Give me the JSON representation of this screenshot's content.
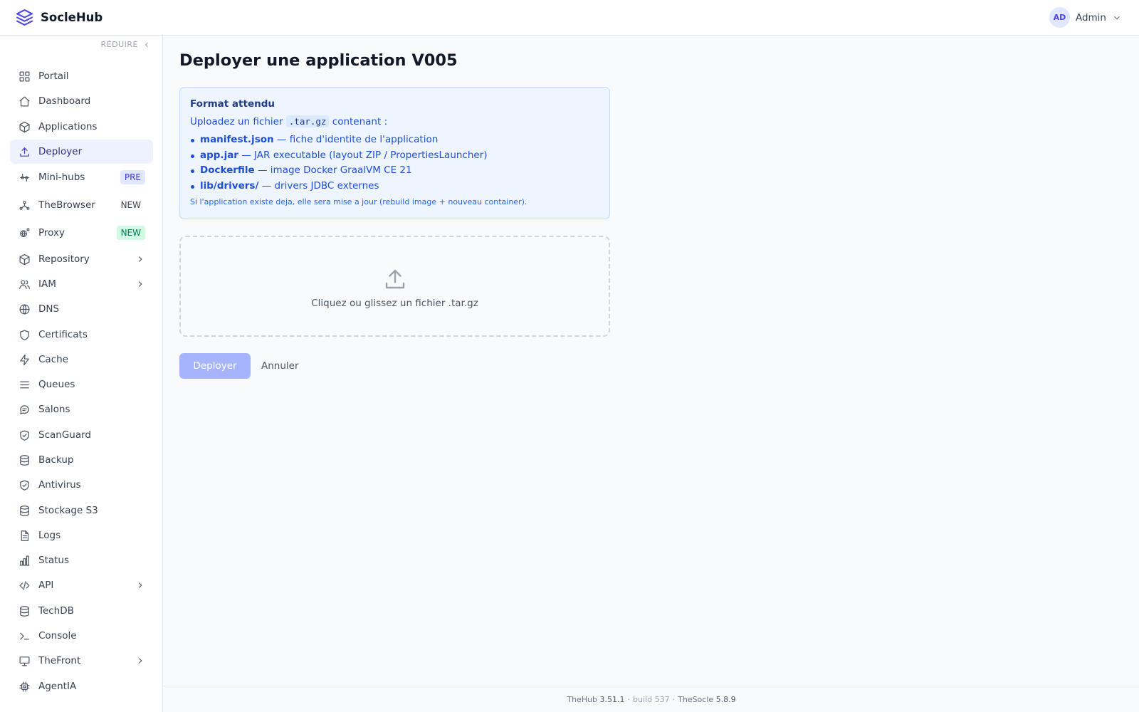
{
  "header": {
    "brand": "SocleHub",
    "avatar_initials": "AD",
    "user_name": "Admin"
  },
  "sidebar": {
    "collapse_label": "RÉDUIRE",
    "items": [
      {
        "label": "Portail",
        "icon": "grid-icon"
      },
      {
        "label": "Dashboard",
        "icon": "home-icon"
      },
      {
        "label": "Applications",
        "icon": "box-icon"
      },
      {
        "label": "Deployer",
        "icon": "upload-icon",
        "active": true
      },
      {
        "label": "Mini-hubs",
        "icon": "sliders-icon",
        "badge": "PRE"
      },
      {
        "label": "TheBrowser",
        "icon": "network-icon",
        "badge": "NEW"
      },
      {
        "label": "Proxy",
        "icon": "proxy-icon",
        "badge": "NEW"
      },
      {
        "label": "Repository",
        "icon": "box-icon",
        "expandable": true
      },
      {
        "label": "IAM",
        "icon": "users-icon",
        "expandable": true
      },
      {
        "label": "DNS",
        "icon": "globe-icon"
      },
      {
        "label": "Certificats",
        "icon": "shield-icon"
      },
      {
        "label": "Cache",
        "icon": "bolt-icon"
      },
      {
        "label": "Queues",
        "icon": "list-icon"
      },
      {
        "label": "Salons",
        "icon": "chat-icon"
      },
      {
        "label": "ScanGuard",
        "icon": "shield-check-icon"
      },
      {
        "label": "Backup",
        "icon": "database-icon"
      },
      {
        "label": "Antivirus",
        "icon": "shield-check-icon"
      },
      {
        "label": "Stockage S3",
        "icon": "database-icon"
      },
      {
        "label": "Logs",
        "icon": "file-icon"
      },
      {
        "label": "Status",
        "icon": "bar-chart-icon"
      },
      {
        "label": "API",
        "icon": "code-icon",
        "expandable": true
      },
      {
        "label": "TechDB",
        "icon": "database-icon"
      },
      {
        "label": "Console",
        "icon": "terminal-icon"
      },
      {
        "label": "TheFront",
        "icon": "monitor-icon",
        "expandable": true
      },
      {
        "label": "AgentIA",
        "icon": "cpu-icon"
      }
    ]
  },
  "main": {
    "title": "Deployer une application V005",
    "info": {
      "title": "Format attendu",
      "intro_before": "Uploadez un fichier",
      "intro_code": ".tar.gz",
      "intro_after": "contenant :",
      "items": [
        {
          "name": "manifest.json",
          "desc": "— fiche d'identite de l'application"
        },
        {
          "name": "app.jar",
          "desc": "— JAR executable (layout ZIP / PropertiesLauncher)"
        },
        {
          "name": "Dockerfile",
          "desc": "— image Docker GraalVM CE 21"
        },
        {
          "name": "lib/drivers/",
          "desc": "— drivers JDBC externes"
        }
      ],
      "note": "Si l'application existe deja, elle sera mise a jour (rebuild image + nouveau container)."
    },
    "dropzone_text": "Cliquez ou glissez un fichier .tar.gz",
    "deploy_button": "Deployer",
    "cancel_button": "Annuler"
  },
  "footer": {
    "thehub_label": "TheHub",
    "thehub_version": "3.51.1",
    "build": "build 537",
    "thesocle_label": "TheSocle",
    "thesocle_version": "5.8.9"
  },
  "colors": {
    "accent": "#4f46e5",
    "active_bg": "#eef2ff",
    "info_bg": "#eef5ff",
    "info_text": "#1d4ed8",
    "button_disabled": "#a5b4fc",
    "badge_new_green": "#d1fae5"
  }
}
